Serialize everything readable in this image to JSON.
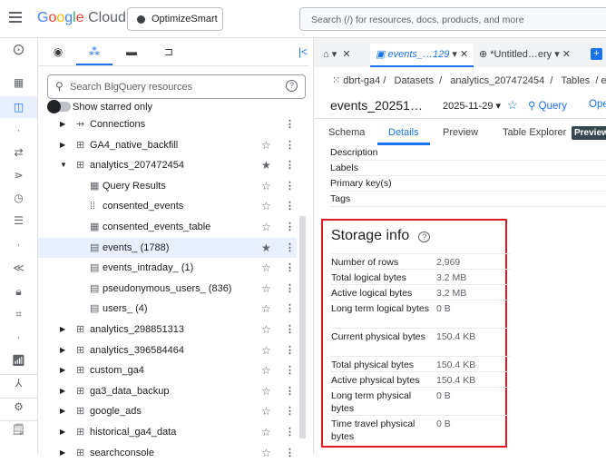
{
  "topbar": {
    "logo": "Google Cloud",
    "project": "OptimizeSmart",
    "search_placeholder": "Search (/) for resources, docs, products, and more"
  },
  "explorer": {
    "search_placeholder": "Search BigQuery resources",
    "starred_toggle": "Show starred only",
    "rows": [
      {
        "label": "Connections",
        "level": 0,
        "caret": "right",
        "icon": "connection",
        "starred": null
      },
      {
        "label": "GA4_native_backfill",
        "level": 0,
        "caret": "right",
        "icon": "dataset",
        "starred": false
      },
      {
        "label": "analytics_207472454",
        "level": 0,
        "caret": "down",
        "icon": "dataset",
        "starred": true
      },
      {
        "label": "Query Results",
        "level": 1,
        "icon": "table",
        "starred": false
      },
      {
        "label": "consented_events",
        "level": 1,
        "icon": "view",
        "starred": false
      },
      {
        "label": "consented_events_table",
        "level": 1,
        "icon": "table",
        "starred": false
      },
      {
        "label": "events_ (1788)",
        "level": 1,
        "icon": "sharded-table",
        "starred": true,
        "selected": true
      },
      {
        "label": "events_intraday_ (1)",
        "level": 1,
        "icon": "sharded-table",
        "starred": false
      },
      {
        "label": "pseudonymous_users_ (836)",
        "level": 1,
        "icon": "sharded-table",
        "starred": false
      },
      {
        "label": "users_ (4)",
        "level": 1,
        "icon": "sharded-table",
        "starred": false
      },
      {
        "label": "analytics_298851313",
        "level": 0,
        "caret": "right",
        "icon": "dataset",
        "starred": false
      },
      {
        "label": "analytics_396584464",
        "level": 0,
        "caret": "right",
        "icon": "dataset",
        "starred": false
      },
      {
        "label": "custom_ga4",
        "level": 0,
        "caret": "right",
        "icon": "dataset",
        "starred": false
      },
      {
        "label": "ga3_data_backup",
        "level": 0,
        "caret": "right",
        "icon": "dataset",
        "starred": false
      },
      {
        "label": "google_ads",
        "level": 0,
        "caret": "right",
        "icon": "dataset",
        "starred": false
      },
      {
        "label": "historical_ga4_data",
        "level": 0,
        "caret": "right",
        "icon": "dataset",
        "starred": false
      },
      {
        "label": "searchconsole",
        "level": 0,
        "caret": "right",
        "icon": "dataset",
        "starred": false
      }
    ]
  },
  "tabs": [
    {
      "label": "events_…129"
    },
    {
      "label": "*Untitled…ery"
    }
  ],
  "breadcrumb": [
    "dbrt-ga4",
    "Datasets",
    "analytics_207472454",
    "Tables",
    "/ ev"
  ],
  "table": {
    "title": "events_20251…",
    "date": "2025-11-29",
    "query": "Query",
    "open": "Ope"
  },
  "subtabs": [
    "Schema",
    "Details",
    "Preview",
    "Table Explorer"
  ],
  "preview_badge": "Preview",
  "details": [
    "Description",
    "Labels",
    "Primary key(s)",
    "Tags"
  ],
  "storage": {
    "title": "Storage info",
    "rows": [
      {
        "k": "Number of rows",
        "v": "2,969"
      },
      {
        "k": "Total logical bytes",
        "v": "3.2 MB"
      },
      {
        "k": "Active logical bytes",
        "v": "3.2 MB"
      },
      {
        "k": "Long term logical bytes",
        "v": "0 B"
      },
      {
        "k": "Current physical bytes",
        "v": "150.4 KB"
      },
      {
        "k": "Total physical bytes",
        "v": "150.4 KB"
      },
      {
        "k": "Active physical bytes",
        "v": "150.4 KB"
      },
      {
        "k": "Long term physical bytes",
        "v": "0 B"
      },
      {
        "k": "Time travel physical bytes",
        "v": "0 B"
      }
    ]
  },
  "colors": {
    "accent": "#1a73e8",
    "highlight": "#e01b24"
  }
}
